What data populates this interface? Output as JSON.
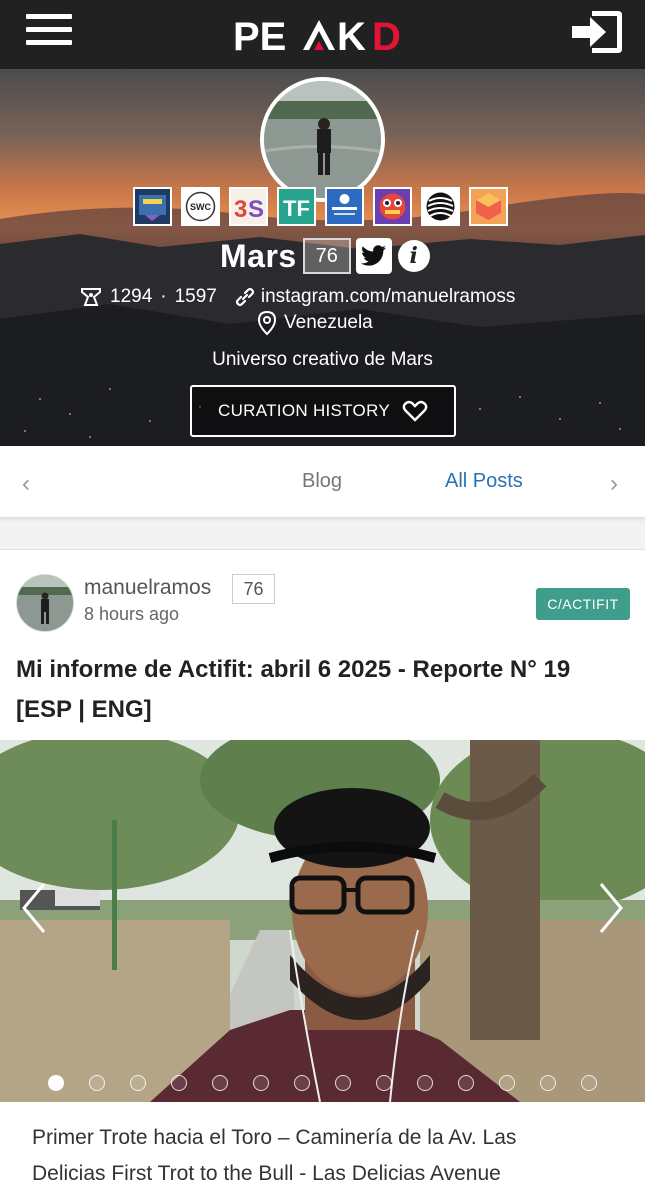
{
  "header": {
    "logo_text": "PEAKD",
    "menu_icon": "hamburger-menu-icon",
    "login_icon": "login-icon"
  },
  "profile": {
    "name": "Mars",
    "reputation": "76",
    "followers": "1294",
    "following": "1597",
    "website": "instagram.com/manuelramoss",
    "location": "Venezuela",
    "about": "Universo creativo de Mars",
    "curation_button": "CURATION HISTORY",
    "badges": [
      "badge-1",
      "badge-swc",
      "badge-3s",
      "badge-tf",
      "badge-referral-10-accounts",
      "badge-6",
      "badge-7",
      "badge-8"
    ]
  },
  "tabs": {
    "items": [
      "Blog",
      "All Posts"
    ],
    "active": "All Posts"
  },
  "post": {
    "author": "manuelramos",
    "reputation": "76",
    "time": "8 hours ago",
    "community": "C/ACTIFIT",
    "title": "Mi informe de Actifit: abril 6 2025 - Reporte N° 19 [ESP | ENG]",
    "excerpt": "Primer Trote hacia el Toro – Caminería de la Av. Las Delicias First Trot to the Bull - Las Delicias Avenue",
    "carousel_dot_count": 14,
    "carousel_active_index": 0
  },
  "colors": {
    "topbar": "#212121",
    "logo_accent": "#e31337",
    "community_tag": "#3f9e8b",
    "active_tab": "#2a72b5"
  }
}
